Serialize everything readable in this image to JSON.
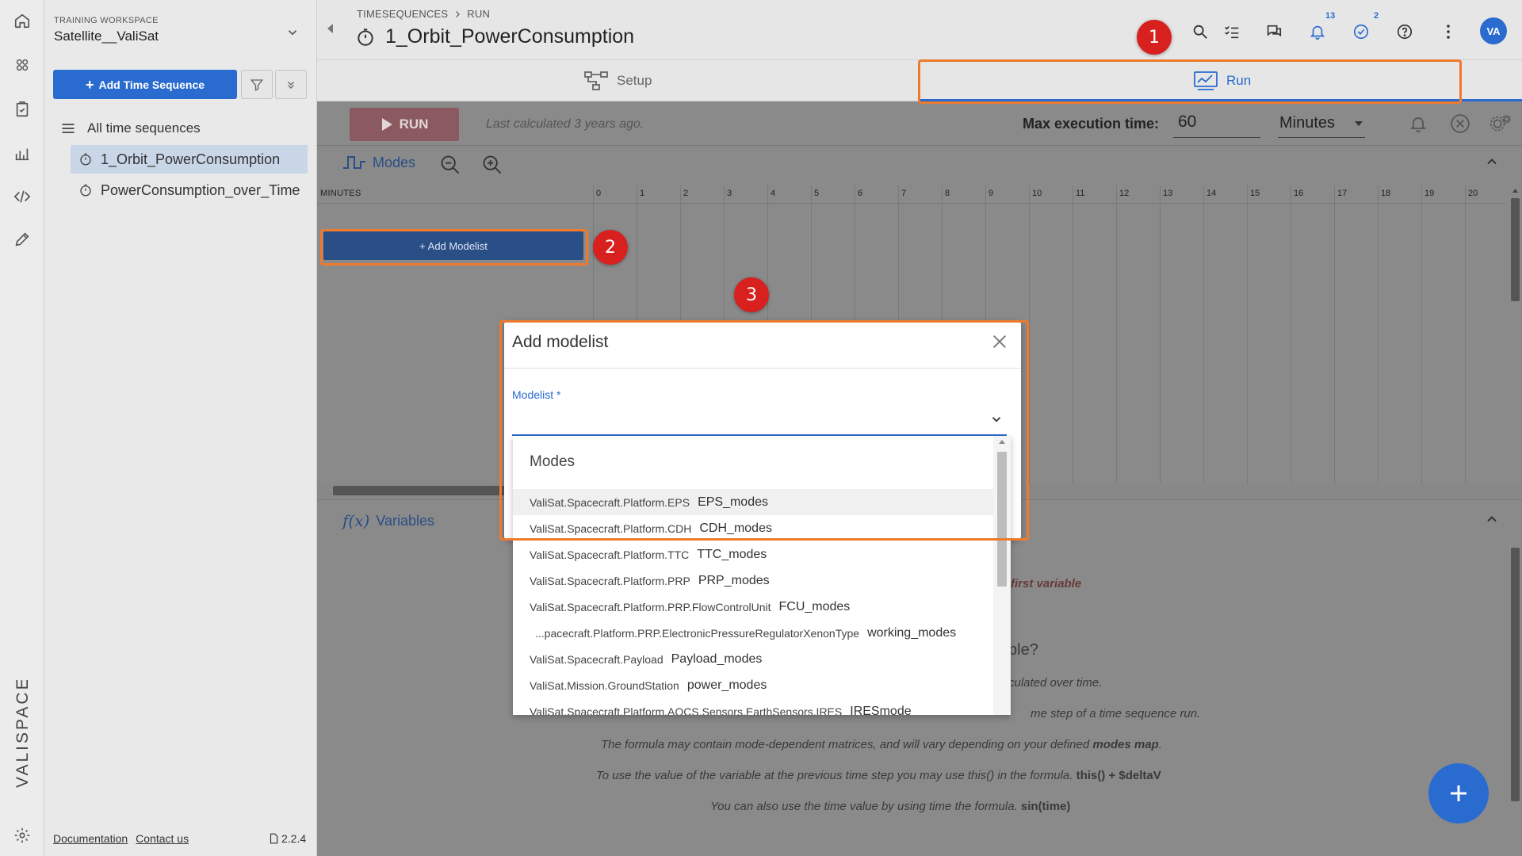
{
  "workspace": {
    "label": "TRAINING WORKSPACE",
    "name": "Satellite__ValiSat"
  },
  "sidebar": {
    "add_button": "Add Time Sequence",
    "all_label": "All time sequences",
    "items": [
      {
        "label": "1_Orbit_PowerConsumption",
        "active": true
      },
      {
        "label": "PowerConsumption_over_Time",
        "active": false
      }
    ],
    "footer": {
      "documentation": "Documentation",
      "contact": "Contact us",
      "version": "2.2.4"
    }
  },
  "brand": {
    "logo_text": "VALISPACE"
  },
  "header": {
    "breadcrumb": [
      "TIMESEQUENCES",
      "RUN"
    ],
    "title": "1_Orbit_PowerConsumption",
    "notifications_badge": "13",
    "tasks_badge": "2",
    "avatar": "VA"
  },
  "tabs": {
    "setup": "Setup",
    "run": "Run"
  },
  "toolbar": {
    "run_label": "RUN",
    "last_calculated": "Last calculated 3 years ago.",
    "max_exec_label": "Max execution time:",
    "max_exec_value": "60",
    "unit": "Minutes"
  },
  "modes": {
    "label": "Modes",
    "minutes_label": "MINUTES",
    "ticks": [
      "0",
      "1",
      "2",
      "3",
      "4",
      "5",
      "6",
      "7",
      "8",
      "9",
      "10",
      "11",
      "12",
      "13",
      "14",
      "15",
      "16",
      "17",
      "18",
      "19",
      "20"
    ],
    "add_modelist": "+ Add Modelist"
  },
  "variables": {
    "label": "Variables",
    "first_variable": "first variable",
    "question_tail": "ble?",
    "hint1": "culated over time.",
    "hint2_a": "me step of a time sequence run.",
    "hint3_a": "The formula may contain mode-dependent matrices, and will vary depending on your defined",
    "hint3_b": "modes map",
    "hint3_c": ".",
    "hint4_a": "To use the value of the variable at the previous time step you may use this() in the formula.",
    "hint4_b": "this() + $deltaV",
    "hint5_a": "You can also use the time value by using time the formula.",
    "hint5_b": "sin(time)"
  },
  "dialog": {
    "title": "Add modelist",
    "field_label": "Modelist *",
    "dropdown_header": "Modes",
    "options": [
      {
        "path": "ValiSat.Spacecraft.Platform.EPS",
        "name": "EPS_modes"
      },
      {
        "path": "ValiSat.Spacecraft.Platform.CDH",
        "name": "CDH_modes"
      },
      {
        "path": "ValiSat.Spacecraft.Platform.TTC",
        "name": "TTC_modes"
      },
      {
        "path": "ValiSat.Spacecraft.Platform.PRP",
        "name": "PRP_modes"
      },
      {
        "path": "ValiSat.Spacecraft.Platform.PRP.FlowControlUnit",
        "name": "FCU_modes"
      },
      {
        "path": "...pacecraft.Platform.PRP.ElectronicPressureRegulatorXenonType",
        "name": "working_modes"
      },
      {
        "path": "ValiSat.Spacecraft.Payload",
        "name": "Payload_modes"
      },
      {
        "path": "ValiSat.Mission.GroundStation",
        "name": "power_modes"
      },
      {
        "path": "ValiSat.Spacecraft.Platform.AOCS.Sensors.EarthSensors.IRES",
        "name": "IRESmode"
      }
    ]
  },
  "annotations": {
    "step1": "1",
    "step2": "2",
    "step3": "3"
  },
  "colors": {
    "accent": "#2a6bd0",
    "highlight": "#ef7a2e",
    "step_marker": "#d8201f"
  }
}
